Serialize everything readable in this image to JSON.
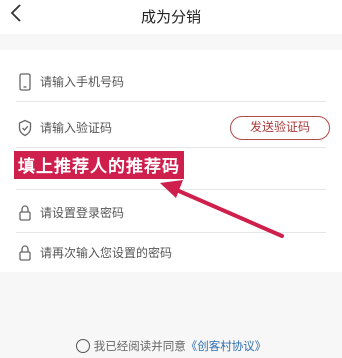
{
  "header": {
    "back_icon": "chevron-left-icon",
    "title": "成为分销"
  },
  "form": {
    "phone": {
      "icon": "phone-icon",
      "placeholder": "请输入手机号码",
      "value": ""
    },
    "code": {
      "icon": "shield-check-icon",
      "placeholder": "请输入验证码",
      "value": "",
      "send_label": "发送验证码"
    },
    "referrer": {
      "placeholder": "填上推荐人的推荐码",
      "value": ""
    },
    "password": {
      "icon": "lock-icon",
      "placeholder": "请设置登录密码",
      "value": ""
    },
    "confirm_password": {
      "icon": "lock-icon",
      "placeholder": "请再次输入您设置的密码",
      "value": ""
    }
  },
  "annotation": {
    "text": "填上推荐人的推荐码",
    "color": "#cf1f4d"
  },
  "agreement": {
    "checked": false,
    "text": "我已经阅读并同意",
    "link": "《创客村协议》"
  },
  "colors": {
    "accent": "#a83a3a",
    "link": "#2f6fb0",
    "background": "#f7f7f7"
  }
}
